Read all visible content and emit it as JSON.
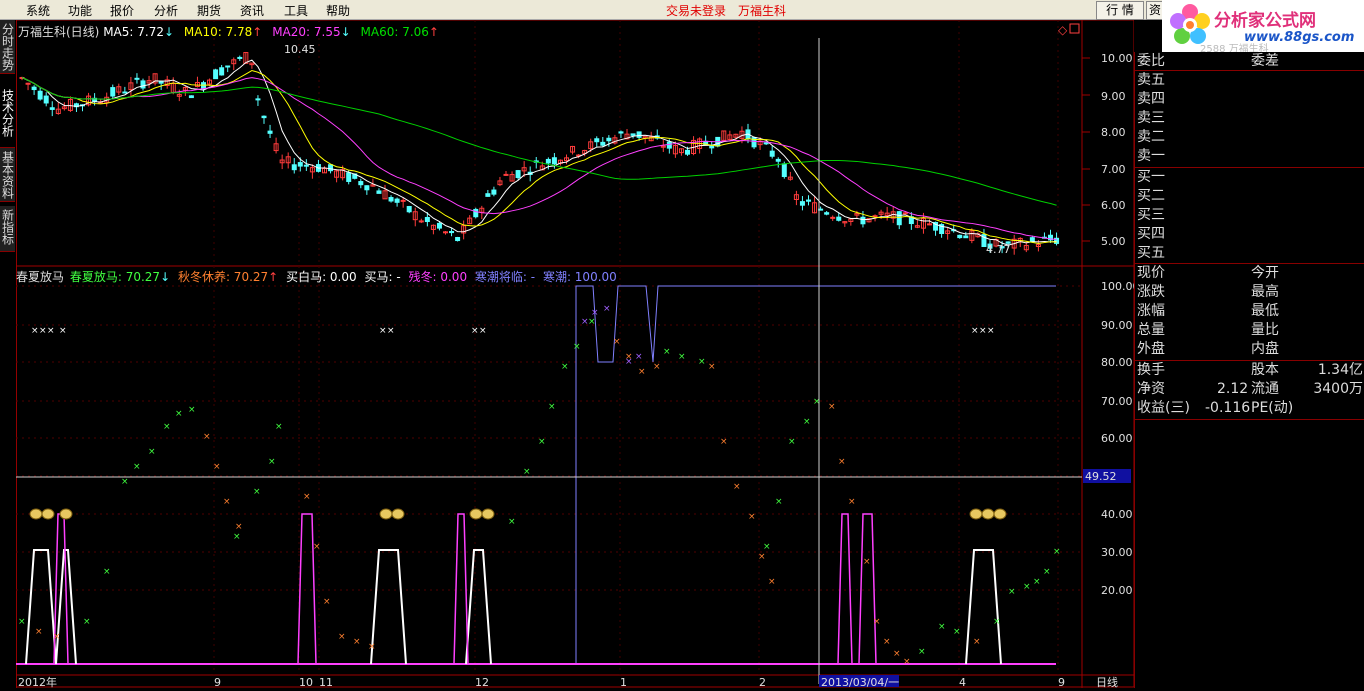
{
  "menu": {
    "items": [
      "系统",
      "功能",
      "报价",
      "分析",
      "期货",
      "资讯",
      "工具",
      "帮助"
    ],
    "status_login": "交易未登录",
    "status_stock": "万福生科",
    "btn_quote": "行 情",
    "btn_extra": "资"
  },
  "logo": {
    "title": "分析家公式网",
    "url": "www.88gs.com",
    "under_text": "2588 万福生科"
  },
  "left_tabs": [
    "分时走势",
    "技术分析",
    "基本资料",
    "新指标"
  ],
  "price_header": {
    "name": "万福生科(日线)",
    "ma5": "MA5: 7.72",
    "ma10": "MA10: 7.78",
    "ma20": "MA20: 7.55",
    "ma60": "MA60: 7.06",
    "high_mark": "10.45",
    "low_mark": "4.77"
  },
  "indicator_header": {
    "name": "春夏放马",
    "chunxia": "春夏放马: 70.27",
    "qiudong": "秋冬休养: 70.27",
    "maibai": "买白马: 0.00",
    "maima": "买马: -",
    "candong": "残冬: 0.00",
    "hanchao_lin": "寒潮将临: -",
    "hanchao": "寒潮: 100.00"
  },
  "cursor_value": "49.52",
  "x_axis": {
    "labels": [
      "2012年",
      "9",
      "10",
      "11",
      "12",
      "1",
      "2",
      "2013/03/04/一",
      "4",
      "9"
    ],
    "period": "日线"
  },
  "price_axis": [
    "10.00",
    "9.00",
    "8.00",
    "7.00",
    "6.00",
    "5.00"
  ],
  "ind_axis": [
    "100.00",
    "90.00",
    "80.00",
    "70.00",
    "60.00",
    "50.00",
    "40.00",
    "30.00",
    "20.00"
  ],
  "colors": {
    "up": "#ff3c3c",
    "down": "#54ffff",
    "ma5": "#ffffff",
    "ma10": "#ffff00",
    "ma20": "#ff40ff",
    "ma60": "#00d000",
    "green_x": "#40ff40",
    "orange_x": "#ff8030",
    "purple_x": "#a060ff",
    "blue_line": "#8080ff",
    "magenta": "#ff40ff"
  },
  "order_book": {
    "weibi": "委比",
    "weicha": "委差",
    "sell": [
      "卖五",
      "卖四",
      "卖三",
      "卖二",
      "卖一"
    ],
    "buy": [
      "买一",
      "买二",
      "买三",
      "买四",
      "买五"
    ]
  },
  "quote_fields": [
    {
      "l": "现价",
      "r": "今开"
    },
    {
      "l": "涨跌",
      "r": "最高"
    },
    {
      "l": "涨幅",
      "r": "最低"
    },
    {
      "l": "总量",
      "r": "量比"
    },
    {
      "l": "外盘",
      "r": "内盘"
    }
  ],
  "fundamentals": [
    {
      "l": "换手",
      "m": "股本",
      "v": "1.34亿"
    },
    {
      "l": "净资",
      "lv": "2.12",
      "m": "流通",
      "v": "3400万"
    },
    {
      "l": "收益(三)",
      "lv": "-0.116",
      "m": "PE(动)",
      "v": ""
    }
  ],
  "chart_data": {
    "type": "candlestick",
    "price_range": [
      4.5,
      10.4
    ],
    "indicator_range": [
      0,
      100
    ],
    "note_cursor_date": "2013/03/04/一"
  }
}
